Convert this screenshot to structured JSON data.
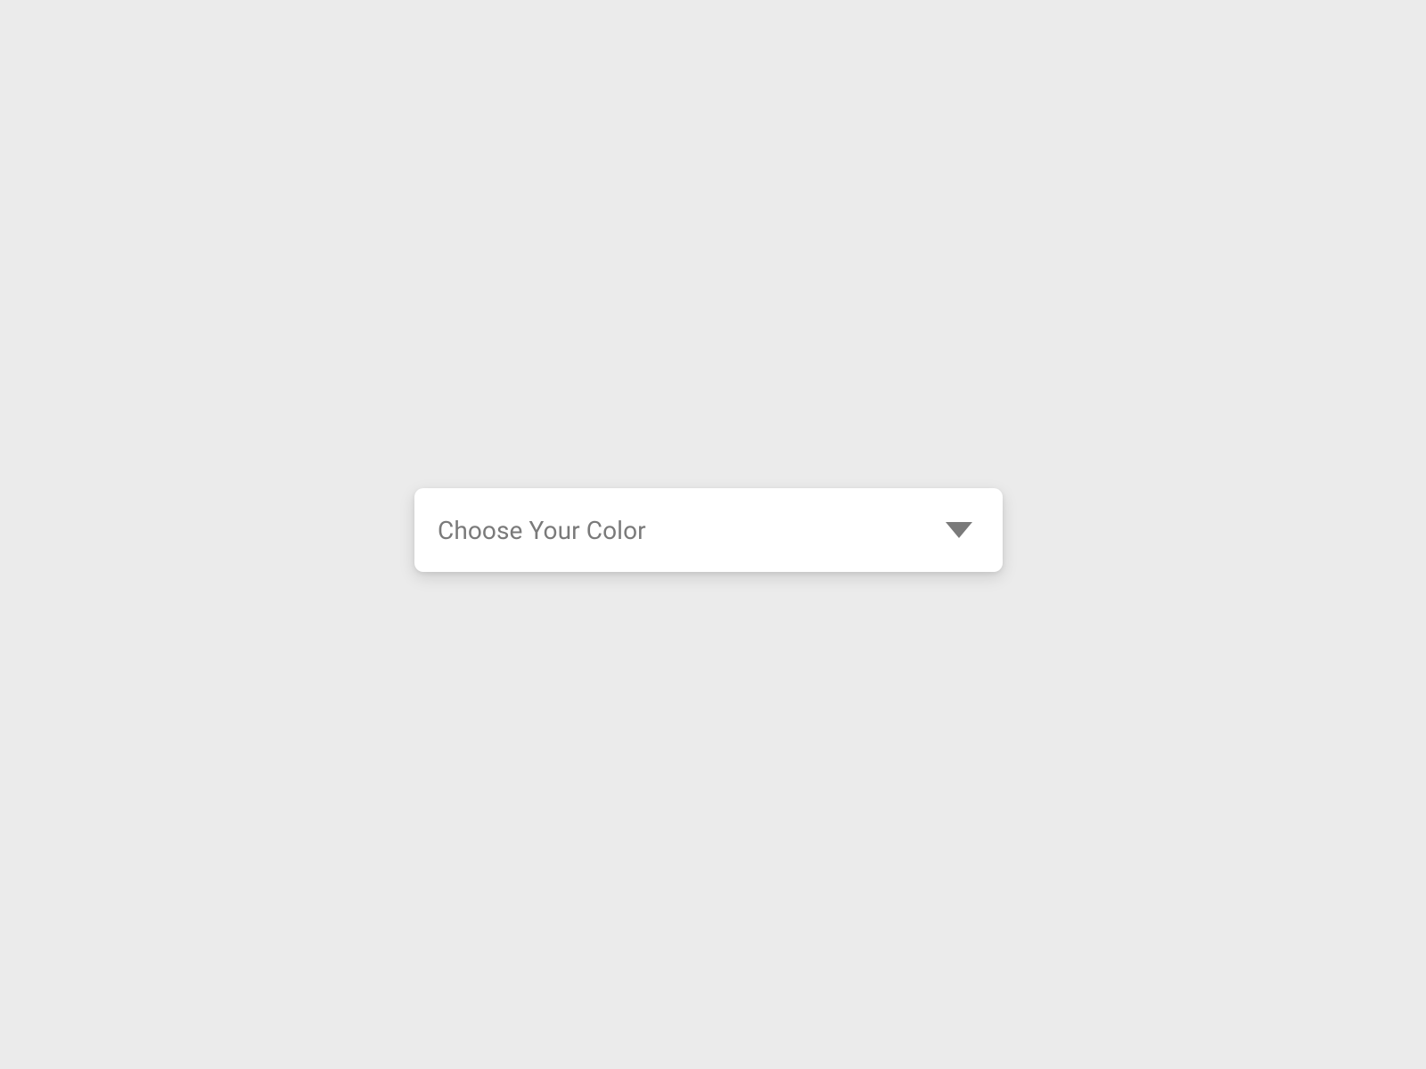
{
  "dropdown": {
    "placeholder": "Choose Your Color"
  }
}
